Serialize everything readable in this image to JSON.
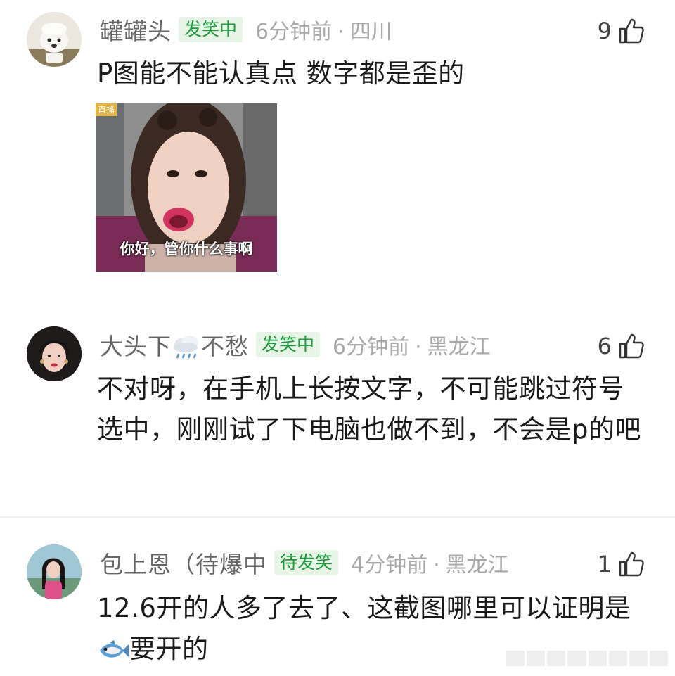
{
  "comments": [
    {
      "username": "罐罐头",
      "badge": "发笑中",
      "time": "6分钟前",
      "location": "四川",
      "likes": "9",
      "text": "P图能不能认真点 数字都是歪的",
      "image_caption": "你好，管你什么事啊",
      "image_watermark": "直播"
    },
    {
      "username_prefix": "大头下",
      "username_suffix": "不愁",
      "username_icon": "cloud-rain-icon",
      "badge": "发笑中",
      "time": "6分钟前",
      "location": "黑龙江",
      "likes": "6",
      "text": "不对呀，在手机上长按文字，不可能跳过符号选中，刚刚试了下电脑也做不到，不会是p的吧"
    },
    {
      "username": "包上恩（待爆中",
      "badge": "待发笑",
      "time": "4分钟前",
      "location": "黑龙江",
      "likes": "1",
      "text_prefix": "12.6开的人多了去了、这截图哪里可以证明是",
      "text_icon": "fish-icon",
      "text_suffix": "要开的"
    }
  ],
  "colors": {
    "badge_text": "#1b9a3a",
    "badge_bg": "#e6f5e6",
    "meta": "#a8a8a8",
    "username": "#666666"
  }
}
